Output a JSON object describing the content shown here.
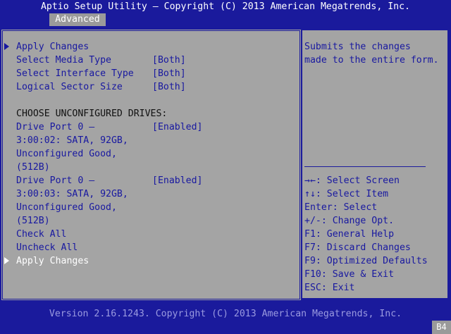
{
  "header": {
    "title": "Aptio Setup Utility – Copyright (C) 2013 American Megatrends, Inc.",
    "tab": "Advanced"
  },
  "menu": {
    "apply_changes_top": "Apply Changes",
    "items": [
      {
        "label": "Select Media Type",
        "value": "[Both]"
      },
      {
        "label": "Select Interface Type",
        "value": "[Both]"
      },
      {
        "label": "Logical Sector Size",
        "value": "[Both]"
      }
    ],
    "section_heading": "CHOOSE UNCONFIGURED DRIVES:",
    "drives": [
      {
        "line1": "Drive Port 0 –",
        "line2": "3:00:02: SATA, 92GB,",
        "line3": "Unconfigured Good,",
        "line4": "(512B)",
        "value": "[Enabled]"
      },
      {
        "line1": "Drive Port 0 –",
        "line2": "3:00:03: SATA, 92GB,",
        "line3": "Unconfigured Good,",
        "line4": "(512B)",
        "value": "[Enabled]"
      }
    ],
    "check_all": "Check All",
    "uncheck_all": "Uncheck All",
    "apply_changes_bottom": "Apply Changes"
  },
  "help": {
    "description_line1": "Submits the changes",
    "description_line2": "made to the entire form.",
    "keys": [
      "→←: Select Screen",
      "↑↓: Select Item",
      "Enter: Select",
      "+/-: Change Opt.",
      "F1: General Help",
      "F7: Discard Changes",
      "F9: Optimized Defaults",
      "F10: Save & Exit",
      "ESC: Exit"
    ]
  },
  "footer": {
    "version": "Version 2.16.1243. Copyright (C) 2013 American Megatrends, Inc.",
    "badge": "B4"
  },
  "colors": {
    "background": "#1a1a9c",
    "panel": "#a4a4a4",
    "item_text": "#1818a0",
    "selected_text": "#ffffff"
  }
}
